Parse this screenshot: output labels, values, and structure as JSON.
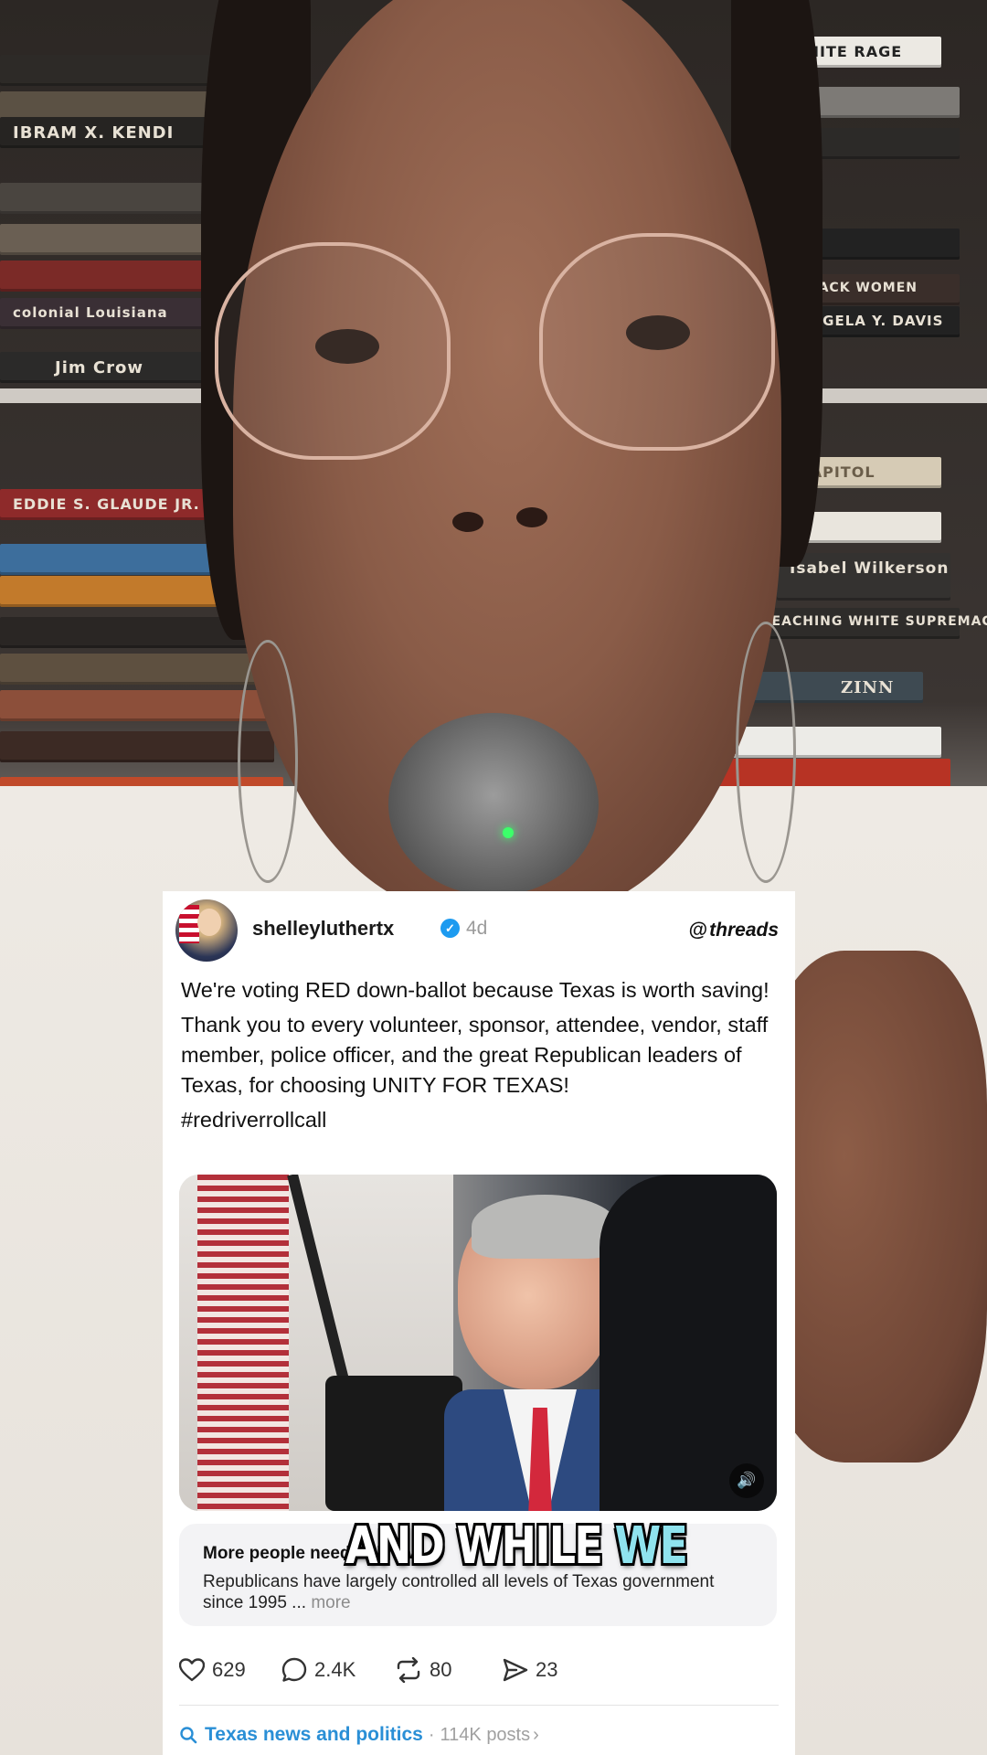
{
  "background": {
    "book_spines": [
      "IBRAM X. KENDI",
      "Jim Crow",
      "colonial Louisiana",
      "EDDIE S. GLAUDE JR.",
      "TEACHING WHITE SUPREMACY",
      "ZINN",
      "Isabel Wilkerson",
      "ANGELA Y. DAVIS",
      "WHITE RAGE",
      "BLACK WOMEN",
      "CAPITOL"
    ]
  },
  "post": {
    "username": "shelleyluthertx",
    "verified_icon": "verified-badge-icon",
    "age": "4d",
    "platform_logo": "threads",
    "text_paragraphs": [
      "We're voting RED down-ballot because Texas is worth saving!",
      "Thank you to every volunteer, sponsor, attendee, vendor, staff member, police officer, and the great Republican leaders of Texas, for choosing UNITY FOR TEXAS!",
      "#redriverrollcall"
    ],
    "media_speaker_icon": "speaker-icon",
    "context": {
      "title": "More people need to know",
      "body": "Republicans have largely controlled all levels of Texas government since 1995 ...",
      "more": "more"
    },
    "actions": {
      "likes": "629",
      "replies": "2.4K",
      "reposts": "80",
      "shares": "23"
    },
    "topic": {
      "label": "Texas news and politics",
      "separator": "·",
      "meta": "114K posts",
      "chevron": "›"
    }
  },
  "caption": {
    "word1": "AND WHILE",
    "word2": "WE"
  },
  "colors": {
    "verified": "#1d9bf0",
    "topic_link": "#2a8fd6",
    "caption_highlight": "#8fe3ee"
  }
}
